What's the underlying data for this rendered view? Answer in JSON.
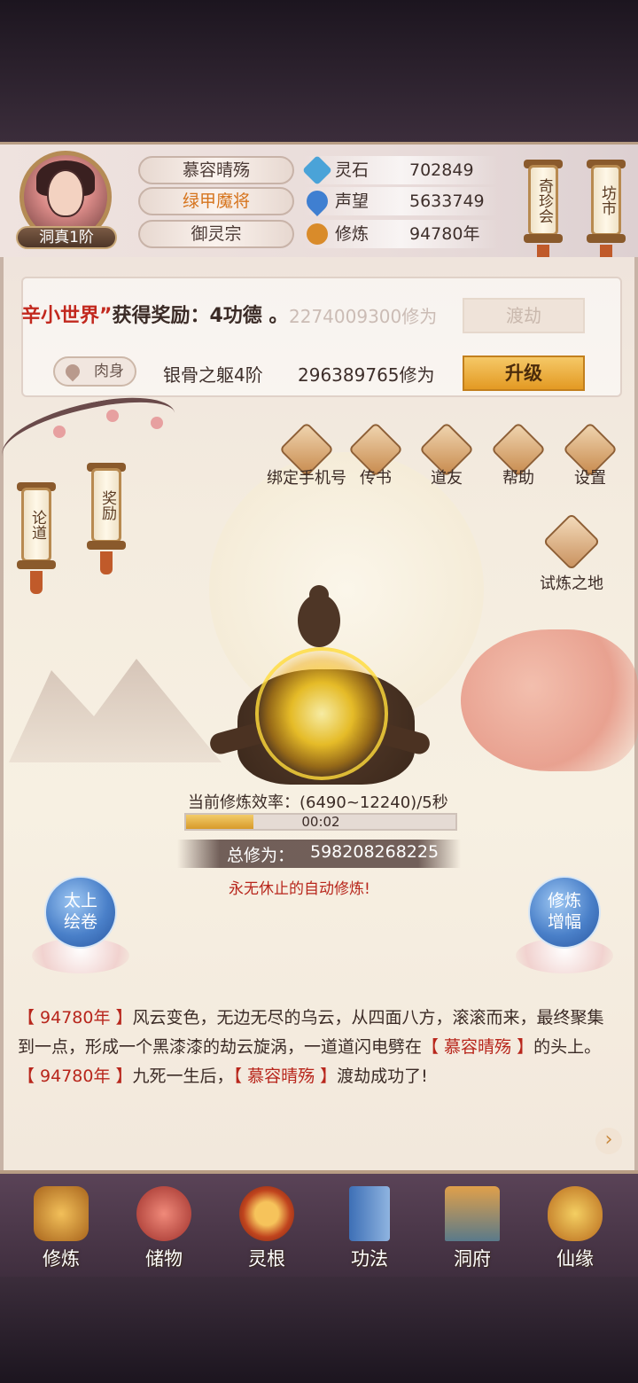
{
  "profile": {
    "rank": "洞真1阶",
    "name": "慕容晴殇",
    "title": "绿甲魔将",
    "sect": "御灵宗"
  },
  "resources": [
    {
      "label": "灵石",
      "value": "702849",
      "icon": "spirit-stone-icon",
      "color": "#4aa3d8"
    },
    {
      "label": "声望",
      "value": "5633749",
      "icon": "reputation-icon",
      "color": "#3f7fd1"
    },
    {
      "label": "修炼",
      "value": "94780年",
      "icon": "meditation-icon",
      "color": "#d98b2a"
    }
  ],
  "side_scrolls": {
    "qizhenhui": "奇珍会",
    "fangshi": "坊市",
    "lundao": "论道",
    "jiangli": "奖励"
  },
  "notice": {
    "highlight": "辛小世界”",
    "rest": "获得奖励：4功德 。"
  },
  "rows": {
    "row1_value": "2274009300修为",
    "row1_button": "渡劫",
    "row2_tag": "肉身",
    "row2_name": "银骨之躯4阶",
    "row2_value": "296389765修为",
    "row2_button": "升级"
  },
  "menu": [
    {
      "label": "绑定手机号",
      "icon": "phone-icon"
    },
    {
      "label": "传书",
      "icon": "mail-icon"
    },
    {
      "label": "道友",
      "icon": "friend-icon"
    },
    {
      "label": "帮助",
      "icon": "help-icon"
    },
    {
      "label": "设置",
      "icon": "gear-icon"
    }
  ],
  "trial": {
    "label": "试炼之地",
    "icon": "trial-ship-icon"
  },
  "cultivation": {
    "rate_label": "当前修炼效率：(6490~12240)/5秒",
    "timer": "00:02",
    "progress": 0.25,
    "total_label": "总修为：",
    "total_value": "598208268225",
    "auto_text": "永无休止的自动修炼!"
  },
  "orbs": {
    "left": [
      "太上",
      "绘卷"
    ],
    "right": [
      "修炼",
      "增幅"
    ]
  },
  "log": {
    "line1_year": "【 94780年 】",
    "line1_text": "风云变色，无边无尽的乌云，从四面八方，滚滚而来，最终聚集到一点，形成一个黑漆漆的劫云旋涡，一道道闪电劈在",
    "line1_name": "【 慕容晴殇 】",
    "line1_end": "的头上。",
    "line2_year": "【 94780年 】",
    "line2_text": "九死一生后，",
    "line2_name": "【 慕容晴殇 】",
    "line2_end": "渡劫成功了!"
  },
  "nav": [
    {
      "label": "修炼",
      "icon": "cultivation-icon"
    },
    {
      "label": "储物",
      "icon": "storage-bag-icon"
    },
    {
      "label": "灵根",
      "icon": "spirit-root-icon"
    },
    {
      "label": "功法",
      "icon": "technique-book-icon"
    },
    {
      "label": "洞府",
      "icon": "cave-dwelling-icon"
    },
    {
      "label": "仙缘",
      "icon": "gourd-icon"
    }
  ]
}
